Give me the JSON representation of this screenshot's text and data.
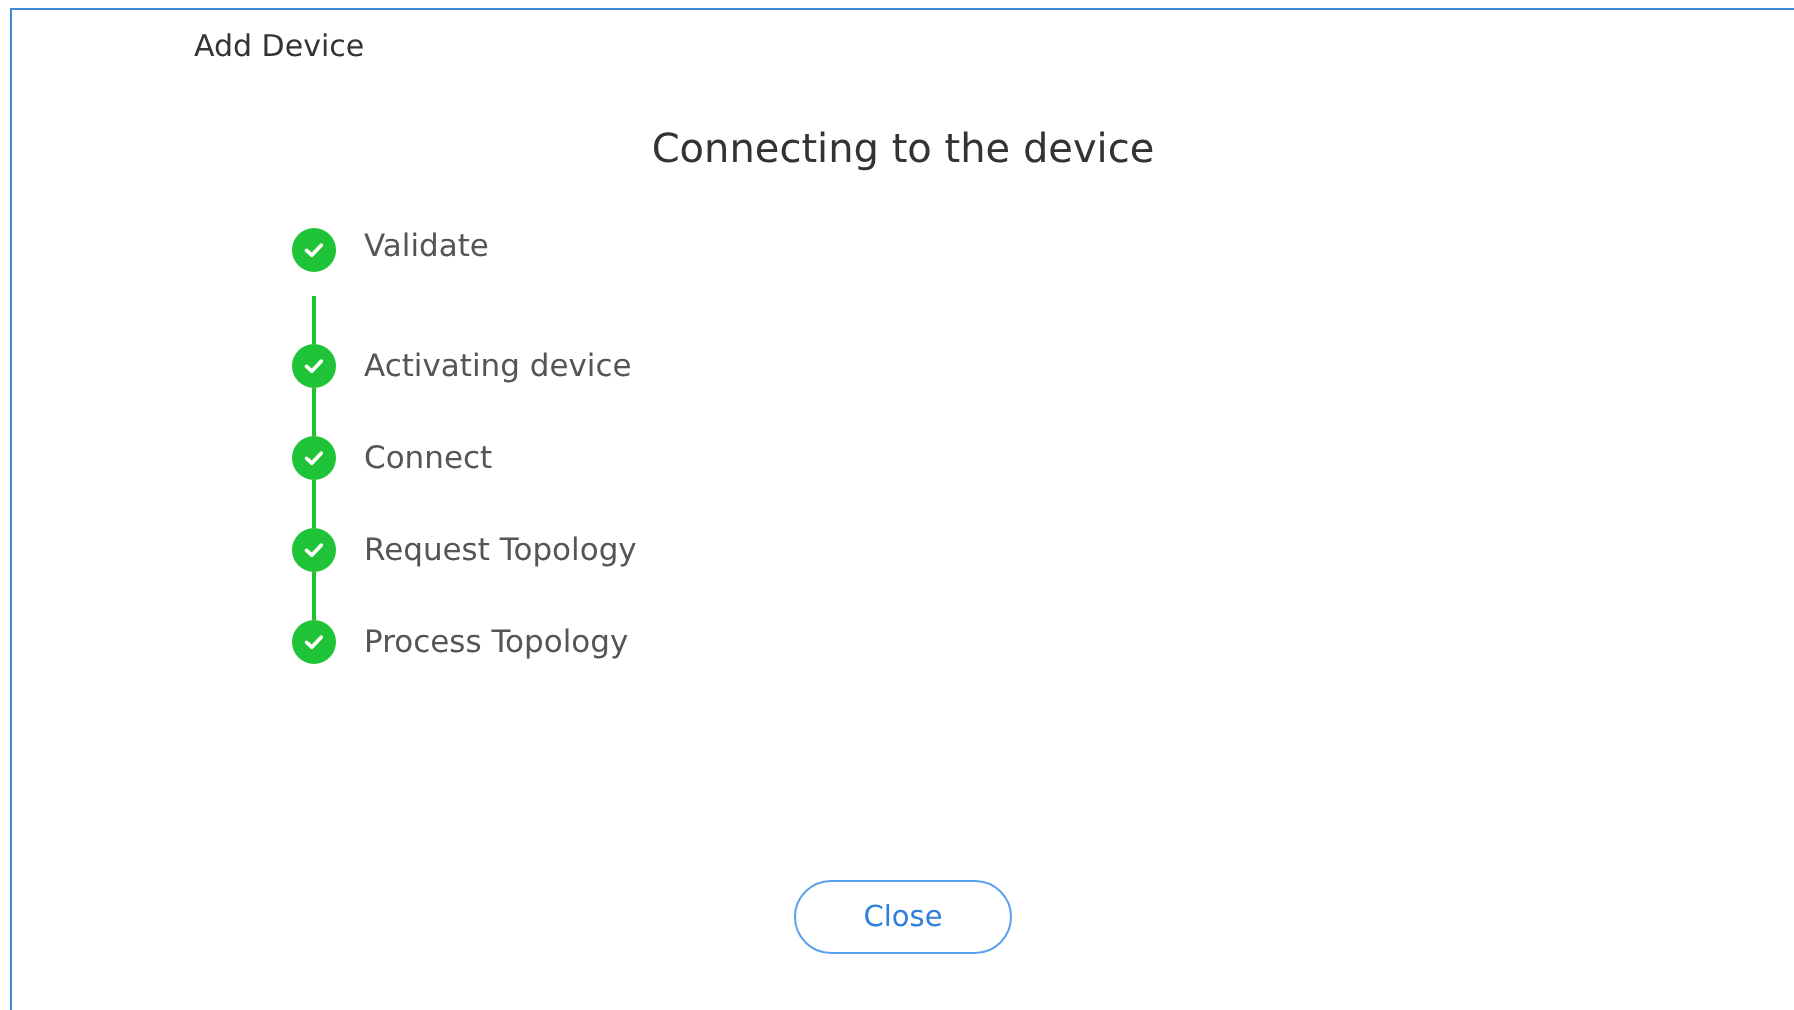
{
  "dialog": {
    "title": "Add Device",
    "heading": "Connecting to the device",
    "steps": [
      {
        "label": "Validate",
        "completed": true
      },
      {
        "label": "Activating device",
        "completed": true
      },
      {
        "label": "Connect",
        "completed": true
      },
      {
        "label": "Request Topology",
        "completed": true
      },
      {
        "label": "Process Topology",
        "completed": true
      }
    ],
    "buttons": [
      "Close"
    ]
  }
}
